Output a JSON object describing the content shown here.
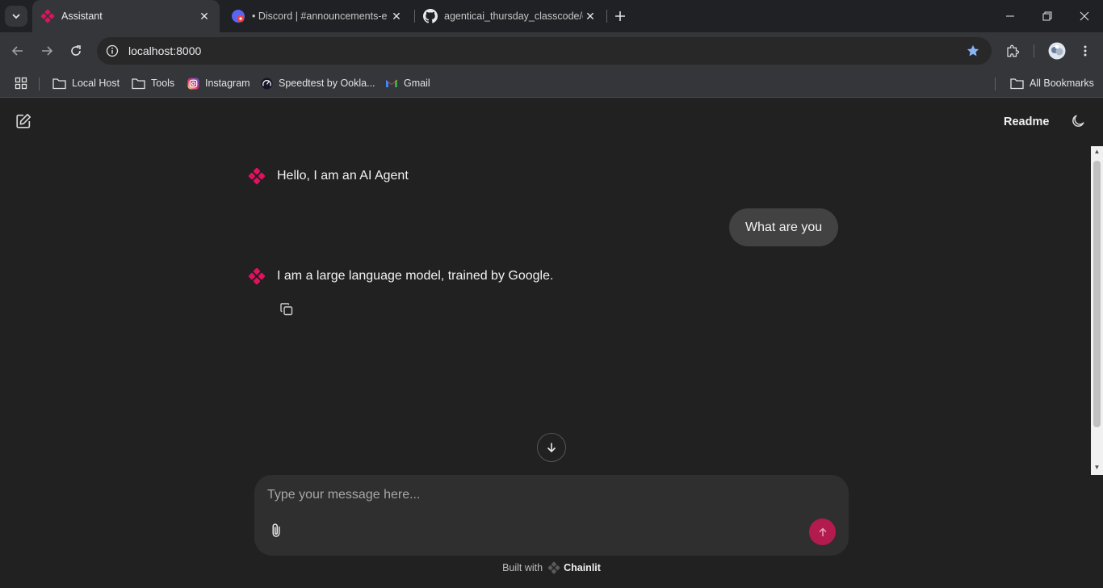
{
  "browser": {
    "tabs": [
      {
        "title": "Assistant",
        "active": true,
        "icon": "chainlit-icon"
      },
      {
        "title": "• Discord | #announcements-e",
        "active": false,
        "icon": "discord-icon"
      },
      {
        "title": "agenticai_thursday_classcode/cl",
        "active": false,
        "icon": "github-icon"
      }
    ],
    "url": "localhost:8000",
    "bookmarks": [
      {
        "label": "Local Host",
        "icon": "folder-icon"
      },
      {
        "label": "Tools",
        "icon": "folder-icon"
      },
      {
        "label": "Instagram",
        "icon": "instagram-icon"
      },
      {
        "label": "Speedtest by Ookla...",
        "icon": "speedtest-icon"
      },
      {
        "label": "Gmail",
        "icon": "gmail-icon"
      }
    ],
    "all_bookmarks": "All Bookmarks"
  },
  "header": {
    "readme": "Readme"
  },
  "messages": [
    {
      "role": "assistant",
      "text": "Hello, I am an AI Agent"
    },
    {
      "role": "user",
      "text": "What are you"
    },
    {
      "role": "assistant",
      "text": "I am a large language model, trained by Google."
    }
  ],
  "composer": {
    "placeholder": "Type your message here..."
  },
  "footer": {
    "built_with": "Built with",
    "brand": "Chainlit"
  },
  "colors": {
    "accent": "#e0115f",
    "send_button": "#b31a4d",
    "background": "#212121"
  }
}
